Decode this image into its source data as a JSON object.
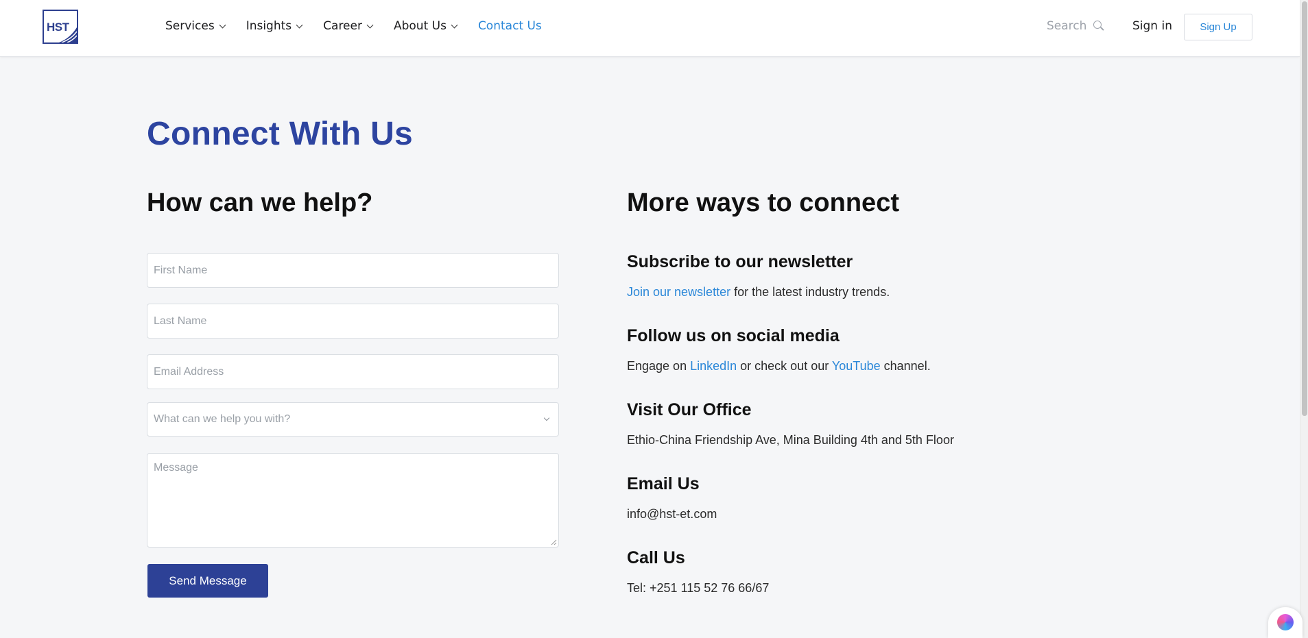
{
  "header": {
    "logo_text": "HST",
    "nav": [
      {
        "label": "Services",
        "dropdown": true
      },
      {
        "label": "Insights",
        "dropdown": true
      },
      {
        "label": "Career",
        "dropdown": true
      },
      {
        "label": "About Us",
        "dropdown": true
      },
      {
        "label": "Contact Us",
        "dropdown": false,
        "active": true
      }
    ],
    "search_label": "Search",
    "signin_label": "Sign in",
    "signup_label": "Sign Up"
  },
  "page": {
    "title": "Connect With Us"
  },
  "form": {
    "heading": "How can we help?",
    "first_name_placeholder": "First Name",
    "last_name_placeholder": "Last Name",
    "email_placeholder": "Email Address",
    "topic_placeholder": "What can we help you with?",
    "message_placeholder": "Message",
    "submit_label": "Send Message"
  },
  "connect": {
    "heading": "More ways to connect",
    "newsletter": {
      "heading": "Subscribe to our newsletter",
      "link": "Join our newsletter",
      "text": " for the latest industry trends."
    },
    "social": {
      "heading": "Follow us on social media",
      "prefix": "Engage on ",
      "linkedin": "LinkedIn",
      "middle": " or check out our ",
      "youtube": "YouTube",
      "suffix": " channel."
    },
    "office": {
      "heading": "Visit Our Office",
      "address": "Ethio-China Friendship Ave, Mina Building 4th and 5th Floor"
    },
    "email": {
      "heading": "Email Us",
      "address": "info@hst-et.com"
    },
    "call": {
      "heading": "Call Us",
      "phone": "Tel: +251 115 52 76 66/67"
    }
  },
  "colors": {
    "brand_blue": "#2d44a0",
    "link_blue": "#2a87d8",
    "button_blue": "#2d4196",
    "background": "#f5f6f8"
  }
}
